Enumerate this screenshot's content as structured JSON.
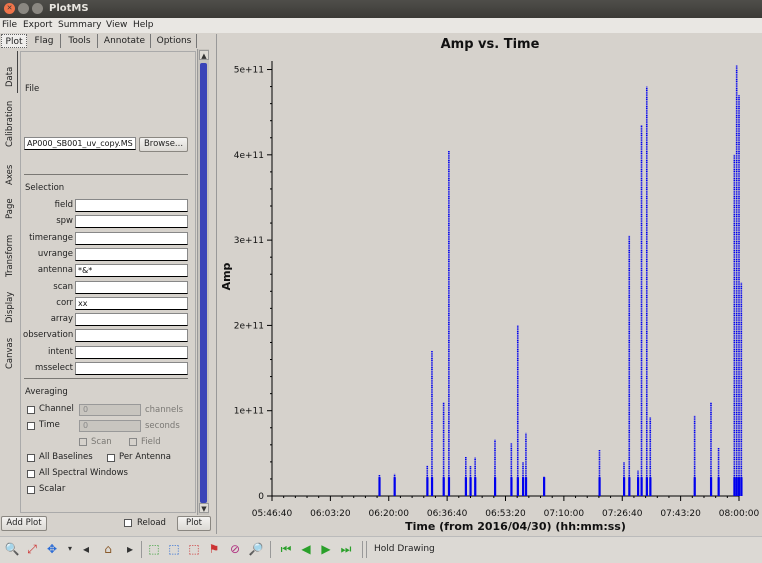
{
  "window": {
    "title": "PlotMS"
  },
  "menu": [
    "File",
    "Export",
    "Summary",
    "View",
    "Help"
  ],
  "tabs": [
    "Plot",
    "Flag",
    "Tools",
    "Annotate",
    "Options"
  ],
  "vtabs": [
    "Data",
    "Calibration",
    "Axes",
    "Page",
    "Transform",
    "Display",
    "Canvas"
  ],
  "data_panel": {
    "file_heading": "File",
    "file_value": "AP000_SB001_uv_copy.MS",
    "browse_label": "Browse...",
    "selection_heading": "Selection",
    "selection_fields": [
      {
        "label": "field",
        "value": ""
      },
      {
        "label": "spw",
        "value": ""
      },
      {
        "label": "timerange",
        "value": ""
      },
      {
        "label": "uvrange",
        "value": ""
      },
      {
        "label": "antenna",
        "value": "*&*"
      },
      {
        "label": "scan",
        "value": ""
      },
      {
        "label": "corr",
        "value": "xx"
      },
      {
        "label": "array",
        "value": ""
      },
      {
        "label": "observation",
        "value": ""
      },
      {
        "label": "intent",
        "value": ""
      },
      {
        "label": "msselect",
        "value": ""
      }
    ],
    "averaging_heading": "Averaging",
    "channel_label": "Channel",
    "channel_value": "0",
    "channel_units": "channels",
    "time_label": "Time",
    "time_value": "0",
    "time_units": "seconds",
    "scan_label": "Scan",
    "field_label": "Field",
    "all_baselines_label": "All Baselines",
    "per_antenna_label": "Per Antenna",
    "all_spw_label": "All Spectral Windows",
    "scalar_label": "Scalar"
  },
  "bottom": {
    "add_plot": "Add Plot",
    "reload": "Reload",
    "plot": "Plot"
  },
  "toolbar": {
    "hold_drawing": "Hold Drawing"
  },
  "chart_data": {
    "type": "scatter",
    "title": "Amp vs. Time",
    "xlabel": "Time (from 2016/04/30) (hh:mm:ss)",
    "ylabel": "Amp",
    "x_ticks": [
      "05:46:40",
      "06:03:20",
      "06:20:00",
      "06:36:40",
      "06:53:20",
      "07:10:00",
      "07:26:40",
      "07:43:20",
      "08:00:00"
    ],
    "y_ticks": [
      "0",
      "1e+11",
      "2e+11",
      "3e+11",
      "4e+11",
      "5e+11"
    ],
    "ylim": [
      0,
      510000000000.0
    ],
    "color": "#0000ee",
    "bursts": [
      {
        "t": "06:17:20",
        "amp": 25000000000.0
      },
      {
        "t": "06:21:40",
        "amp": 26000000000.0
      },
      {
        "t": "06:31:00",
        "amp": 36000000000.0
      },
      {
        "t": "06:32:20",
        "amp": 170000000000.0
      },
      {
        "t": "06:35:40",
        "amp": 110000000000.0
      },
      {
        "t": "06:37:10",
        "amp": 405000000000.0
      },
      {
        "t": "06:42:00",
        "amp": 46000000000.0
      },
      {
        "t": "06:43:20",
        "amp": 35000000000.0
      },
      {
        "t": "06:44:40",
        "amp": 45000000000.0
      },
      {
        "t": "06:50:20",
        "amp": 66000000000.0
      },
      {
        "t": "06:55:00",
        "amp": 62000000000.0
      },
      {
        "t": "06:56:50",
        "amp": 200000000000.0
      },
      {
        "t": "06:58:20",
        "amp": 40000000000.0
      },
      {
        "t": "06:59:10",
        "amp": 74000000000.0
      },
      {
        "t": "07:04:20",
        "amp": 23000000000.0
      },
      {
        "t": "07:20:10",
        "amp": 54000000000.0
      },
      {
        "t": "07:27:10",
        "amp": 40000000000.0
      },
      {
        "t": "07:28:40",
        "amp": 305000000000.0
      },
      {
        "t": "07:31:10",
        "amp": 30000000000.0
      },
      {
        "t": "07:32:10",
        "amp": 435000000000.0
      },
      {
        "t": "07:33:40",
        "amp": 480000000000.0
      },
      {
        "t": "07:34:40",
        "amp": 92000000000.0
      },
      {
        "t": "07:47:20",
        "amp": 94000000000.0
      },
      {
        "t": "07:52:00",
        "amp": 110000000000.0
      },
      {
        "t": "07:54:10",
        "amp": 57000000000.0
      },
      {
        "t": "07:58:40",
        "amp": 400000000000.0
      },
      {
        "t": "07:59:20",
        "amp": 505000000000.0
      },
      {
        "t": "08:00:00",
        "amp": 470000000000.0
      },
      {
        "t": "08:00:40",
        "amp": 250000000000.0
      }
    ]
  }
}
